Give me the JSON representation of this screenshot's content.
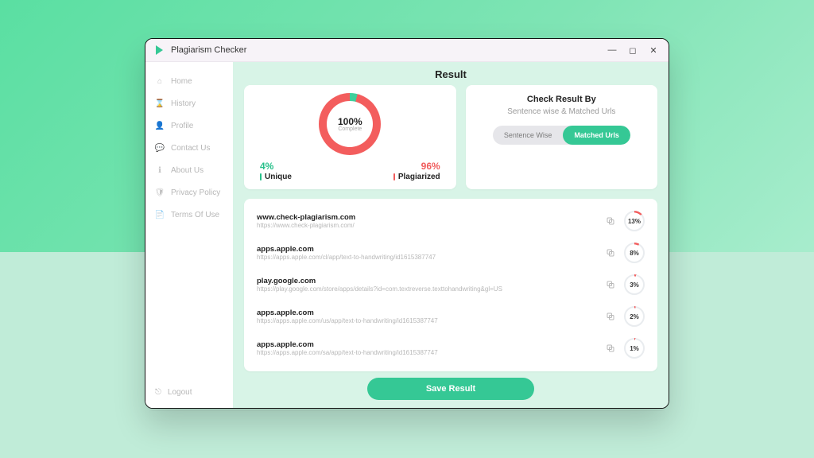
{
  "app": {
    "title": "Plagiarism Checker"
  },
  "window_controls": {
    "min": "—",
    "max": "◻",
    "close": "✕"
  },
  "sidebar": {
    "items": [
      {
        "label": "Home",
        "icon": "home-icon"
      },
      {
        "label": "History",
        "icon": "history-icon"
      },
      {
        "label": "Profile",
        "icon": "profile-icon"
      },
      {
        "label": "Contact Us",
        "icon": "chat-icon"
      },
      {
        "label": "About Us",
        "icon": "info-icon"
      },
      {
        "label": "Privacy Policy",
        "icon": "shield-icon"
      },
      {
        "label": "Terms Of Use",
        "icon": "doc-icon"
      }
    ],
    "logout_label": "Logout"
  },
  "main": {
    "title": "Result",
    "progress": {
      "percent_label": "100%",
      "complete_label": "Complete",
      "unique_pct": "4%",
      "unique_label": "Unique",
      "plag_pct": "96%",
      "plag_label": "Plagiarized"
    },
    "mode": {
      "title": "Check Result By",
      "subtitle": "Sentence wise & Matched Urls",
      "option_a": "Sentence Wise",
      "option_b": "Matched Urls",
      "active": "b"
    },
    "results": [
      {
        "host": "www.check-plagiarism.com",
        "url": "https://www.check-plagiarism.com/",
        "pct": "13%",
        "pct_num": 13
      },
      {
        "host": "apps.apple.com",
        "url": "https://apps.apple.com/cl/app/text-to-handwriting/id1615387747",
        "pct": "8%",
        "pct_num": 8
      },
      {
        "host": "play.google.com",
        "url": "https://play.google.com/store/apps/details?id=com.textreverse.texttohandwriting&gl=US",
        "pct": "3%",
        "pct_num": 3
      },
      {
        "host": "apps.apple.com",
        "url": "https://apps.apple.com/us/app/text-to-handwriting/id1615387747",
        "pct": "2%",
        "pct_num": 2
      },
      {
        "host": "apps.apple.com",
        "url": "https://apps.apple.com/sa/app/text-to-handwriting/id1615387747",
        "pct": "1%",
        "pct_num": 1
      }
    ],
    "save_label": "Save Result"
  },
  "colors": {
    "accent": "#35c895",
    "danger": "#f35d5d"
  },
  "chart_data": {
    "type": "pie",
    "title": "Plagiarism ratio",
    "categories": [
      "Unique",
      "Plagiarized"
    ],
    "values": [
      4,
      96
    ],
    "center_label": "100% Complete"
  }
}
